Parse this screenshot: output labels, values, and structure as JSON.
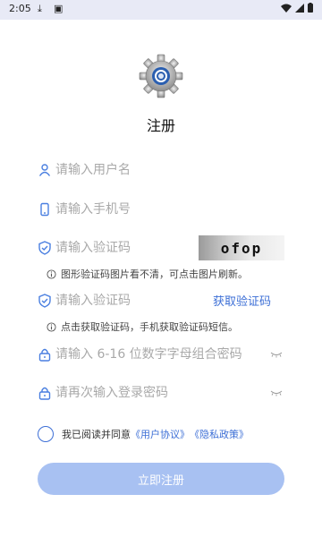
{
  "status_bar": {
    "time": "2:05"
  },
  "app": {
    "title": "注册"
  },
  "form": {
    "username": {
      "placeholder": "请输入用户名"
    },
    "phone": {
      "placeholder": "请输入手机号"
    },
    "image_captcha": {
      "placeholder": "请输入验证码",
      "image_text": "ofop",
      "hint": "图形验证码图片看不清，可点击图片刷新。"
    },
    "sms_code": {
      "placeholder": "请输入验证码",
      "get_code_label": "获取验证码",
      "hint": "点击获取验证码，手机获取验证码短信。"
    },
    "password": {
      "placeholder": "请输入 6-16 位数字字母组合密码"
    },
    "confirm_password": {
      "placeholder": "请再次输入登录密码"
    }
  },
  "agreement": {
    "prefix": "我已阅读并同意",
    "user_agreement": "《用户协议》",
    "privacy_policy": "《隐私政策》"
  },
  "submit_label": "立即注册",
  "colors": {
    "accent": "#3d6fd6",
    "button_disabled": "#a8c1f2",
    "icon_blue": "#4a7fe0"
  }
}
